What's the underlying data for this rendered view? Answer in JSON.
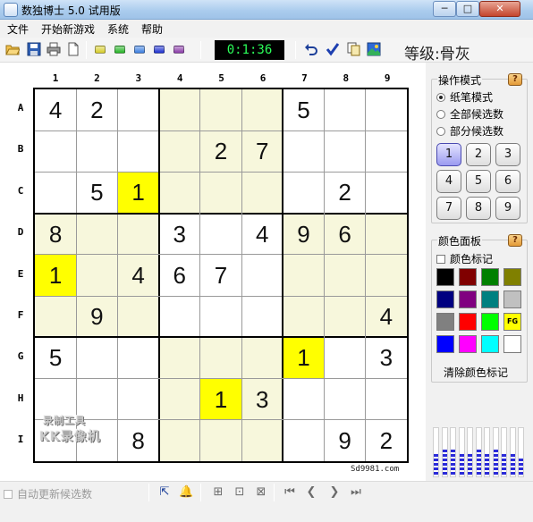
{
  "window": {
    "title": "数独博士 5.0 试用版",
    "minimize": "─",
    "maximize": "□",
    "close": "✕"
  },
  "menu": [
    "文件",
    "开始新游戏",
    "系统",
    "帮助"
  ],
  "toolbar": {
    "timer": "0:1:36",
    "level_label": "等级:骨灰",
    "gem_colors": [
      "#d6cc2a",
      "#24b324",
      "#3a7ee0",
      "#1c2fd0",
      "#8a3aa8"
    ]
  },
  "board": {
    "columns": [
      "1",
      "2",
      "3",
      "4",
      "5",
      "6",
      "7",
      "8",
      "9"
    ],
    "rows": [
      "A",
      "B",
      "C",
      "D",
      "E",
      "F",
      "G",
      "H",
      "I"
    ],
    "highlight_color": "#ffff00",
    "box_tint": "#f7f7dc",
    "cells": [
      [
        "4",
        "2",
        "",
        "",
        "",
        "",
        "5",
        "",
        ""
      ],
      [
        "",
        "",
        "",
        "",
        "2",
        "7",
        "",
        "",
        ""
      ],
      [
        "",
        "5",
        "1",
        "",
        "",
        "",
        "",
        "2",
        ""
      ],
      [
        "8",
        "",
        "",
        "3",
        "",
        "4",
        "9",
        "6",
        ""
      ],
      [
        "1",
        "",
        "4",
        "6",
        "7",
        "",
        "",
        "",
        ""
      ],
      [
        "",
        "9",
        "",
        "",
        "",
        "",
        "",
        "",
        "4"
      ],
      [
        "5",
        "",
        "",
        "",
        "",
        "",
        "1",
        "",
        "3"
      ],
      [
        "",
        "",
        "",
        "",
        "1",
        "3",
        "",
        "",
        ""
      ],
      [
        "",
        "",
        "8",
        "",
        "",
        "",
        "",
        "9",
        "2"
      ]
    ],
    "highlighted": [
      "C3",
      "E1",
      "G7",
      "H5"
    ],
    "credit": "Sd9981.com",
    "watermark": [
      "录制工具",
      "KK录像机"
    ]
  },
  "mode_panel": {
    "title": "操作模式",
    "help": "?",
    "options": [
      {
        "label": "纸笔模式",
        "selected": true
      },
      {
        "label": "全部候选数",
        "selected": false
      },
      {
        "label": "部分候选数",
        "selected": false
      }
    ],
    "numbers": [
      "1",
      "2",
      "3",
      "4",
      "5",
      "6",
      "7",
      "8",
      "9"
    ],
    "selected_number": "1"
  },
  "color_panel": {
    "title": "颜色面板",
    "help": "?",
    "mark_label": "颜色标记",
    "swatches": [
      "#000000",
      "#800000",
      "#008000",
      "#808000",
      "#000080",
      "#800080",
      "#008080",
      "#c0c0c0",
      "#808080",
      "#ff0000",
      "#00ff00",
      "#ffff00",
      "#0000ff",
      "#ff00ff",
      "#00ffff",
      "#ffffff"
    ],
    "fg_label": "FG",
    "clear_label": "清除颜色标记"
  },
  "status": {
    "auto_update_label": "自动更新候选数"
  }
}
